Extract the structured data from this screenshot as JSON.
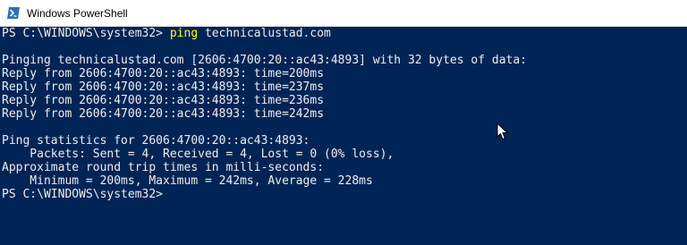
{
  "window": {
    "title": "Windows PowerShell",
    "app_icon": "powershell-icon"
  },
  "console": {
    "background": "#012456",
    "foreground": "#eeedf0",
    "command_color": "#ffff00",
    "prompt": "PS C:\\WINDOWS\\system32> ",
    "command": "ping",
    "argument": " technicalustad.com",
    "output_lines": [
      "",
      "Pinging technicalustad.com [2606:4700:20::ac43:4893] with 32 bytes of data:",
      "Reply from 2606:4700:20::ac43:4893: time=200ms",
      "Reply from 2606:4700:20::ac43:4893: time=237ms",
      "Reply from 2606:4700:20::ac43:4893: time=236ms",
      "Reply from 2606:4700:20::ac43:4893: time=242ms",
      "",
      "Ping statistics for 2606:4700:20::ac43:4893:",
      "    Packets: Sent = 4, Received = 4, Lost = 0 (0% loss),",
      "Approximate round trip times in milli-seconds:",
      "    Minimum = 200ms, Maximum = 242ms, Average = 228ms",
      "PS C:\\WINDOWS\\system32>"
    ]
  },
  "cursor_icon": "mouse-pointer-icon"
}
